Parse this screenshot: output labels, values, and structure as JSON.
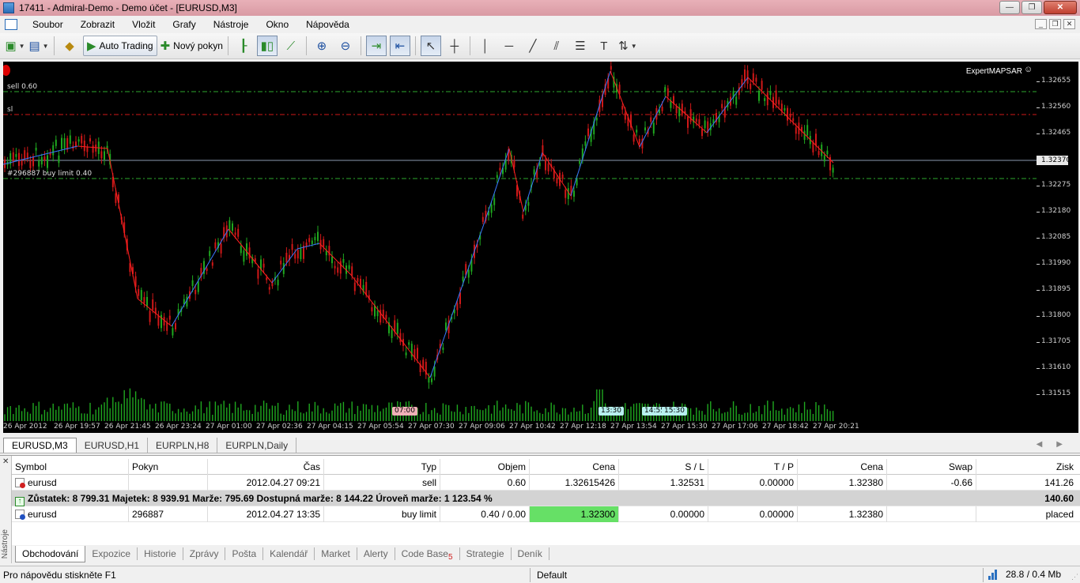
{
  "window": {
    "title": "17411 - Admiral-Demo - Demo účet - [EURUSD,M3]",
    "controls": [
      "minimize",
      "maximize",
      "close"
    ]
  },
  "menu": [
    "Soubor",
    "Zobrazit",
    "Vložit",
    "Grafy",
    "Nástroje",
    "Okno",
    "Nápověda"
  ],
  "toolbar": {
    "auto_trading": "Auto Trading",
    "new_order": "Nový pokyn"
  },
  "chart": {
    "symbol_label": "EURUSD,M3",
    "ea_name": "ExpertMAPSAR",
    "order_labels": {
      "sell": "sell 0.60",
      "sl": "sl",
      "buy_limit": "#296887 buy limit 0.40"
    },
    "price_ticks": [
      "1.32655",
      "1.32560",
      "1.32465",
      "1.32275",
      "1.32180",
      "1.32085",
      "1.31990",
      "1.31895",
      "1.31800",
      "1.31705",
      "1.31610",
      "1.31515"
    ],
    "current_price": "1.32370",
    "time_ticks": [
      "26 Apr 2012",
      "26 Apr 19:57",
      "26 Apr 21:45",
      "26 Apr 23:24",
      "27 Apr 01:00",
      "27 Apr 02:36",
      "27 Apr 04:15",
      "27 Apr 05:54",
      "27 Apr 07:30",
      "27 Apr 09:06",
      "27 Apr 10:42",
      "27 Apr 12:18",
      "27 Apr 13:54",
      "27 Apr 15:30",
      "27 Apr 17:06",
      "27 Apr 18:42",
      "27 Apr 20:21"
    ],
    "event_tags": [
      "07:00",
      "13:30",
      "14:55",
      "15:30"
    ],
    "colors": {
      "background": "#000000",
      "bull": "#1fa81f",
      "bear": "#d01818",
      "zigzag_up": "#3a78ff",
      "zigzag_down": "#ff2020",
      "order_line": "#2ea82e",
      "sl_line": "#d01818",
      "price_line": "#8a9ab0",
      "volume": "#1fa81f"
    }
  },
  "chart_tabs": [
    "EURUSD,M3",
    "EURUSD,H1",
    "EURPLN,H8",
    "EURPLN,Daily"
  ],
  "terminal": {
    "side_label": "Nástroje",
    "columns": [
      "Symbol",
      "Pokyn",
      "Čas",
      "Typ",
      "Objem",
      "Cena",
      "S / L",
      "T / P",
      "Cena",
      "Swap",
      "Zisk"
    ],
    "rows": [
      {
        "symbol": "eurusd",
        "ticket": "",
        "time": "2012.04.27 09:21",
        "type": "sell",
        "volume": "0.60",
        "price": "1.32615426",
        "sl": "1.32531",
        "tp": "0.00000",
        "current": "1.32380",
        "swap": "-0.66",
        "profit": "141.26"
      },
      {
        "symbol": "eurusd",
        "ticket": "296887",
        "time": "2012.04.27 13:35",
        "type": "buy limit",
        "volume": "0.40 / 0.00",
        "price": "1.32300",
        "sl": "0.00000",
        "tp": "0.00000",
        "current": "1.32380",
        "swap": "",
        "profit": "placed"
      }
    ],
    "balance": {
      "text": "Zůstatek: 8 799.31  Majetek: 8 939.91  Marže: 795.69  Dostupná marže: 8 144.22  Úroveň marže: 1 123.54 %",
      "profit": "140.60"
    },
    "tabs": [
      "Obchodování",
      "Expozice",
      "Historie",
      "Zprávy",
      "Pošta",
      "Kalendář",
      "Market",
      "Alerty",
      "Code Base",
      "Strategie",
      "Deník"
    ],
    "code_base_badge": "5"
  },
  "status": {
    "help": "Pro nápovědu stiskněte F1",
    "profile": "Default",
    "connection": "28.8 / 0.4 Mb"
  }
}
